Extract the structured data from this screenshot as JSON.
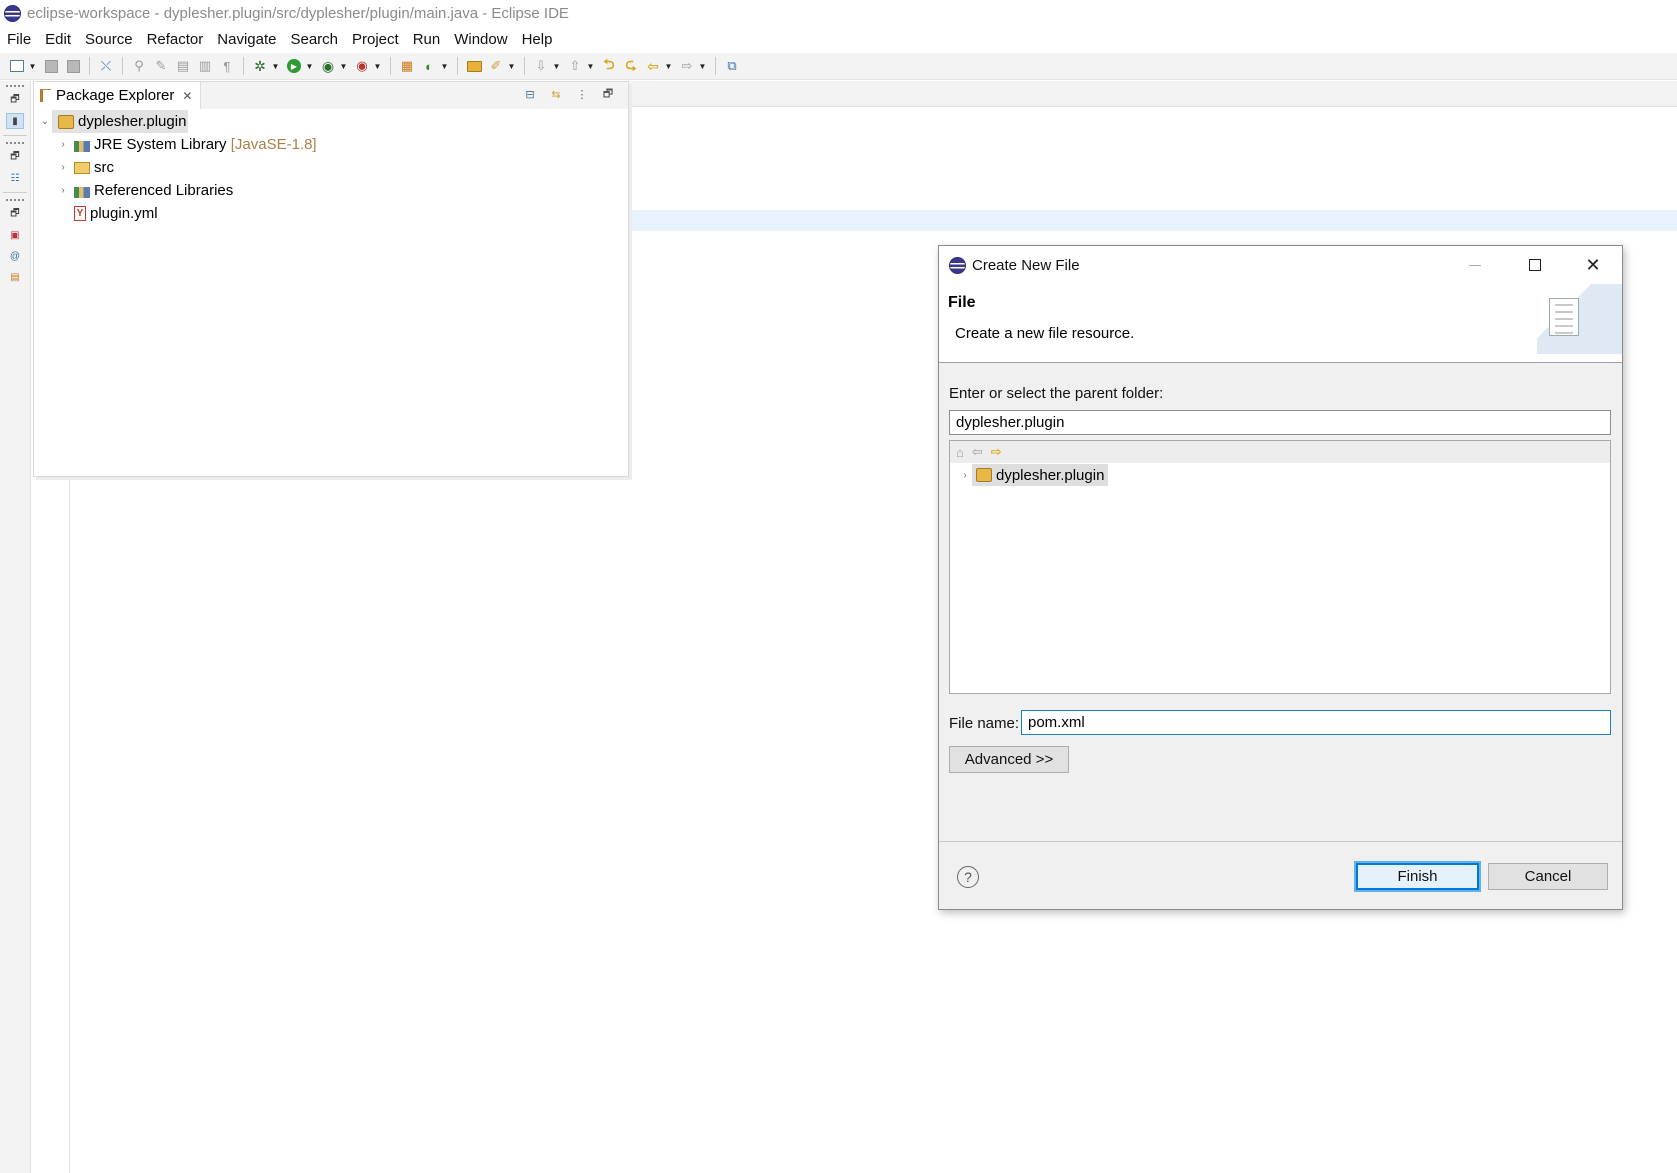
{
  "window": {
    "title": "eclipse-workspace - dyplesher.plugin/src/dyplesher/plugin/main.java - Eclipse IDE"
  },
  "menu": [
    "File",
    "Edit",
    "Source",
    "Refactor",
    "Navigate",
    "Search",
    "Project",
    "Run",
    "Window",
    "Help"
  ],
  "package_explorer": {
    "tab_label": "Package Explorer",
    "close_glyph": "✕",
    "tree": {
      "project": "dyplesher.plugin",
      "children": [
        {
          "label": "JRE System Library",
          "suffix": "[JavaSE-1.8]",
          "icon": "library-icon"
        },
        {
          "label": "src",
          "suffix": "",
          "icon": "package-folder-icon"
        },
        {
          "label": "Referenced Libraries",
          "suffix": "",
          "icon": "library-icon"
        },
        {
          "label": "plugin.yml",
          "suffix": "",
          "icon": "yaml-file-icon"
        }
      ]
    }
  },
  "dialog": {
    "title": "Create New File",
    "header_title": "File",
    "header_description": "Create a new file resource.",
    "parent_folder_label": "Enter or select the parent folder:",
    "parent_folder_value": "dyplesher.plugin",
    "tree_item": "dyplesher.plugin",
    "file_name_label": "File name:",
    "file_name_value": "pom.xml",
    "advanced_button": "Advanced >>",
    "finish_button": "Finish",
    "cancel_button": "Cancel",
    "help_glyph": "?"
  },
  "colors": {
    "accent_focus": "#0078d7",
    "selection": "#e2e2e2",
    "decoration_text": "#a9834a"
  }
}
